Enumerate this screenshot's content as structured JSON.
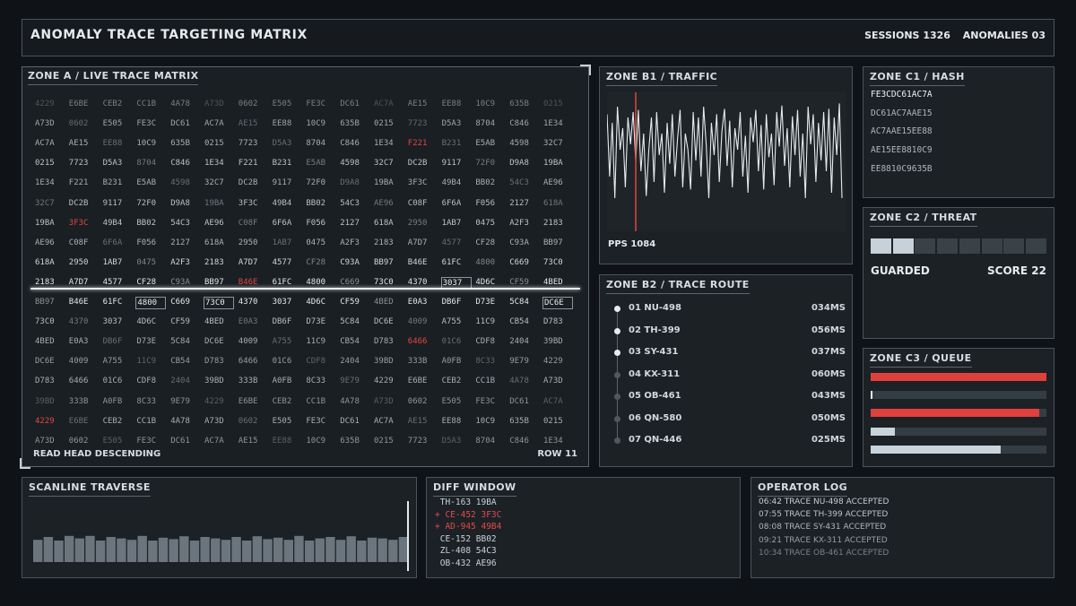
{
  "header": {
    "title": "ANOMALY TRACE TARGETING MATRIX",
    "sessions": "SESSIONS 1326",
    "anomalies": "ANOMALIES 03"
  },
  "zoneA": {
    "title": "ZONE A / LIVE TRACE MATRIX",
    "footer_left": "READ HEAD DESCENDING",
    "footer_right": "ROW 11",
    "rows": [
      [
        "4229",
        "E6BE",
        "CEB2",
        "CC1B",
        "4A78",
        "A73D",
        "0602",
        "E505",
        "FE3C",
        "DC61",
        "AC7A",
        "AE15",
        "EE88",
        "10C9",
        "635B",
        "0215"
      ],
      [
        "A73D",
        "0602",
        "E505",
        "FE3C",
        "DC61",
        "AC7A",
        "AE15",
        "EE88",
        "10C9",
        "635B",
        "0215",
        "7723",
        "D5A3",
        "8704",
        "C846",
        "1E34"
      ],
      [
        "AC7A",
        "AE15",
        "EE88",
        "10C9",
        "635B",
        "0215",
        "7723",
        "D5A3",
        "8704",
        "C846",
        "1E34",
        "F221",
        "B231",
        "E5AB",
        "4598",
        "32C7"
      ],
      [
        "0215",
        "7723",
        "D5A3",
        "8704",
        "C846",
        "1E34",
        "F221",
        "B231",
        "E5AB",
        "4598",
        "32C7",
        "DC2B",
        "9117",
        "72F0",
        "D9A8",
        "19BA"
      ],
      [
        "1E34",
        "F221",
        "B231",
        "E5AB",
        "4598",
        "32C7",
        "DC2B",
        "9117",
        "72F0",
        "D9A8",
        "19BA",
        "3F3C",
        "49B4",
        "BB02",
        "54C3",
        "AE96"
      ],
      [
        "32C7",
        "DC2B",
        "9117",
        "72F0",
        "D9A8",
        "19BA",
        "3F3C",
        "49B4",
        "BB02",
        "54C3",
        "AE96",
        "C08F",
        "6F6A",
        "F056",
        "2127",
        "618A"
      ],
      [
        "19BA",
        "3F3C",
        "49B4",
        "BB02",
        "54C3",
        "AE96",
        "C08F",
        "6F6A",
        "F056",
        "2127",
        "618A",
        "2950",
        "1AB7",
        "0475",
        "A2F3",
        "2183"
      ],
      [
        "AE96",
        "C08F",
        "6F6A",
        "F056",
        "2127",
        "618A",
        "2950",
        "1AB7",
        "0475",
        "A2F3",
        "2183",
        "A7D7",
        "4577",
        "CF28",
        "C93A",
        "BB97"
      ],
      [
        "618A",
        "2950",
        "1AB7",
        "0475",
        "A2F3",
        "2183",
        "A7D7",
        "4577",
        "CF28",
        "C93A",
        "BB97",
        "B46E",
        "61FC",
        "4800",
        "C669",
        "73C0"
      ],
      [
        "2183",
        "A7D7",
        "4577",
        "CF28",
        "C93A",
        "BB97",
        "B46E",
        "61FC",
        "4800",
        "C669",
        "73C0",
        "4370",
        "3037",
        "4D6C",
        "CF59",
        "4BED"
      ],
      [
        "BB97",
        "B46E",
        "61FC",
        "4800",
        "C669",
        "73C0",
        "4370",
        "3037",
        "4D6C",
        "CF59",
        "4BED",
        "E0A3",
        "DB6F",
        "D73E",
        "5C84",
        "DC6E"
      ],
      [
        "73C0",
        "4370",
        "3037",
        "4D6C",
        "CF59",
        "4BED",
        "E0A3",
        "DB6F",
        "D73E",
        "5C84",
        "DC6E",
        "4009",
        "A755",
        "11C9",
        "CB54",
        "D783"
      ],
      [
        "4BED",
        "E0A3",
        "DB6F",
        "D73E",
        "5C84",
        "DC6E",
        "4009",
        "A755",
        "11C9",
        "CB54",
        "D783",
        "6466",
        "01C6",
        "CDF8",
        "2404",
        "39BD"
      ],
      [
        "DC6E",
        "4009",
        "A755",
        "11C9",
        "CB54",
        "D783",
        "6466",
        "01C6",
        "CDF8",
        "2404",
        "39BD",
        "333B",
        "A0FB",
        "8C33",
        "9E79",
        "4229"
      ],
      [
        "D783",
        "6466",
        "01C6",
        "CDF8",
        "2404",
        "39BD",
        "333B",
        "A0FB",
        "8C33",
        "9E79",
        "4229",
        "E6BE",
        "CEB2",
        "CC1B",
        "4A78",
        "A73D"
      ],
      [
        "39BD",
        "333B",
        "A0FB",
        "8C33",
        "9E79",
        "4229",
        "E6BE",
        "CEB2",
        "CC1B",
        "4A78",
        "A73D",
        "0602",
        "E505",
        "FE3C",
        "DC61",
        "AC7A"
      ],
      [
        "4229",
        "E6BE",
        "CEB2",
        "CC1B",
        "4A78",
        "A73D",
        "0602",
        "E505",
        "FE3C",
        "DC61",
        "AC7A",
        "AE15",
        "EE88",
        "10C9",
        "635B",
        "0215"
      ],
      [
        "A73D",
        "0602",
        "E505",
        "FE3C",
        "DC61",
        "AC7A",
        "AE15",
        "EE88",
        "10C9",
        "635B",
        "0215",
        "7723",
        "D5A3",
        "8704",
        "C846",
        "1E34"
      ]
    ],
    "row_brightness": [
      0.32,
      0.55,
      0.6,
      0.72,
      0.6,
      0.7,
      0.72,
      0.62,
      0.85,
      0.95,
      0.95,
      0.7,
      0.6,
      0.5,
      0.6,
      0.45,
      0.6,
      0.45
    ],
    "red_cells": [
      [
        2,
        11
      ],
      [
        6,
        1
      ],
      [
        9,
        6
      ],
      [
        12,
        11
      ],
      [
        16,
        0
      ]
    ],
    "boxed_cells": [
      [
        9,
        12
      ],
      [
        10,
        3
      ],
      [
        10,
        5
      ],
      [
        10,
        15
      ]
    ],
    "colors": {
      "red": "#e0473f",
      "bright": "#e8edf1"
    }
  },
  "zoneB1": {
    "title": "ZONE B1 / TRAFFIC",
    "pps": "PPS 1084",
    "series": [
      0.88,
      0.3,
      0.8,
      0.1,
      0.95,
      0.55,
      0.75,
      0.2,
      0.85,
      0.6,
      0.9,
      0.45,
      0.92,
      0.35,
      0.7,
      0.12,
      0.55,
      0.85,
      0.25,
      0.9,
      0.5,
      0.7,
      0.15,
      0.8,
      0.42,
      0.88,
      0.3,
      0.65,
      0.92,
      0.2,
      0.7,
      0.55,
      0.18,
      0.9,
      0.45,
      0.85,
      0.3,
      0.95,
      0.6,
      0.1,
      0.8,
      0.5,
      0.88,
      0.25,
      0.72,
      0.93,
      0.4,
      0.82,
      0.2,
      0.75,
      0.55,
      0.9,
      0.3,
      0.68,
      0.15,
      0.85,
      0.62,
      0.92,
      0.35,
      0.78,
      0.18,
      0.88,
      0.48,
      0.7,
      0.22,
      0.9,
      0.58,
      0.96,
      0.4,
      0.75,
      0.2,
      0.86,
      0.5,
      0.92,
      0.3,
      0.7,
      0.1,
      0.95,
      0.6,
      0.88,
      0.25,
      0.8,
      0.45,
      0.9,
      0.35,
      0.93,
      0.15,
      0.85,
      0.5,
      0.98,
      0.1
    ],
    "marker_index": 11,
    "colors": {
      "line": "#e6ebef",
      "marker": "#e0473f"
    }
  },
  "zoneB2": {
    "title": "ZONE B2 / TRACE ROUTE",
    "routes": [
      {
        "label": "01 NU-498",
        "ms": "034MS",
        "active": true
      },
      {
        "label": "02 TH-399",
        "ms": "056MS",
        "active": true
      },
      {
        "label": "03 SY-431",
        "ms": "037MS",
        "active": true
      },
      {
        "label": "04 KX-311",
        "ms": "060MS",
        "active": false
      },
      {
        "label": "05 OB-461",
        "ms": "043MS",
        "active": false
      },
      {
        "label": "06 QN-580",
        "ms": "050MS",
        "active": false
      },
      {
        "label": "07 QN-446",
        "ms": "025MS",
        "active": false
      }
    ]
  },
  "zoneC1": {
    "title": "ZONE C1 / HASH",
    "hashes": [
      "FE3CDC61AC7A",
      "DC61AC7AAE15",
      "AC7AAE15EE88",
      "AE15EE8810C9",
      "EE8810C9635B"
    ]
  },
  "zoneC2": {
    "title": "ZONE C2 / THREAT",
    "segments_total": 8,
    "segments_on": 2,
    "status": "GUARDED",
    "score": "SCORE 22"
  },
  "zoneC3": {
    "title": "ZONE C3 / QUEUE",
    "bars": [
      {
        "fill": 1.0,
        "color": "#e0403b"
      },
      {
        "fill": 0.01,
        "color": "#e6ebef"
      },
      {
        "fill": 0.96,
        "color": "#e0403b"
      },
      {
        "fill": 0.14,
        "color": "#c9d3dc"
      },
      {
        "fill": 0.74,
        "color": "#c9d3dc"
      }
    ]
  },
  "scanline": {
    "title": "SCANLINE TRAVERSE",
    "bars": [
      0.62,
      0.7,
      0.6,
      0.73,
      0.66,
      0.73,
      0.6,
      0.7,
      0.66,
      0.62,
      0.73,
      0.6,
      0.68,
      0.64,
      0.72,
      0.6,
      0.7,
      0.66,
      0.62,
      0.7,
      0.6,
      0.72,
      0.64,
      0.68,
      0.62,
      0.73,
      0.6,
      0.66,
      0.7,
      0.62,
      0.72,
      0.6,
      0.68,
      0.66,
      0.62,
      0.7
    ],
    "colors": {
      "bar": "#6b757e",
      "cursor": "#e6ebef"
    }
  },
  "diff": {
    "title": "DIFF WINDOW",
    "rows": [
      {
        "text": " TH-163 19BA",
        "added": false
      },
      {
        "text": "+ CE-452 3F3C",
        "added": true
      },
      {
        "text": "+ AD-945 49B4",
        "added": true
      },
      {
        "text": " CE-152 BB02",
        "added": false
      },
      {
        "text": " ZL-408 54C3",
        "added": false
      },
      {
        "text": " OB-432 AE96",
        "added": false
      }
    ]
  },
  "oplog": {
    "title": "OPERATOR LOG",
    "entries": [
      {
        "text": "06:42 TRACE NU-498 ACCEPTED",
        "dim": 1.0
      },
      {
        "text": "07:55 TRACE TH-399 ACCEPTED",
        "dim": 0.95
      },
      {
        "text": "08:08 TRACE SY-431 ACCEPTED",
        "dim": 0.85
      },
      {
        "text": "09:21 TRACE KX-311 ACCEPTED",
        "dim": 0.72
      },
      {
        "text": "10:34 TRACE OB-461 ACCEPTED",
        "dim": 0.55
      }
    ]
  }
}
